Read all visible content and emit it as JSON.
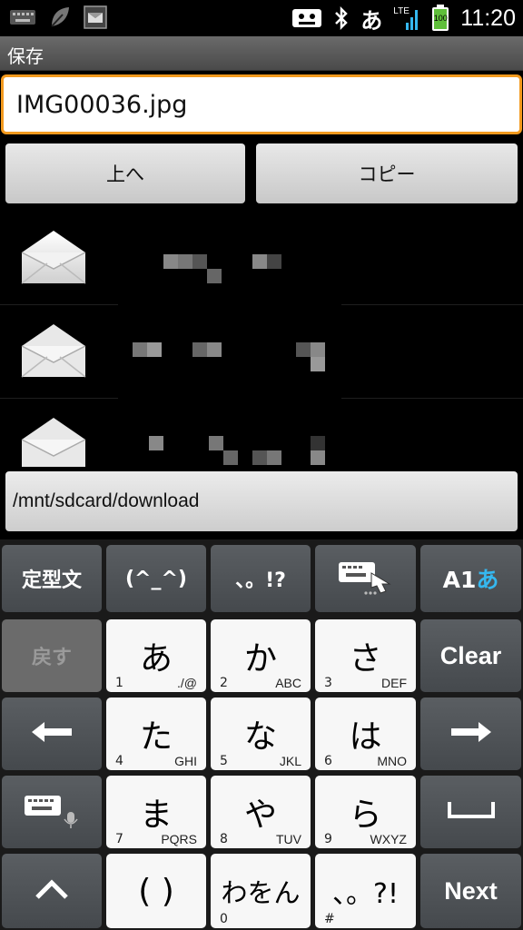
{
  "status_bar": {
    "time": "11:20",
    "input_mode": "あ",
    "network": "LTE",
    "battery": "100"
  },
  "title_bar": {
    "title": "保存"
  },
  "filename_field": {
    "value": "IMG00036.jpg"
  },
  "buttons": {
    "up": "上へ",
    "copy": "コピー"
  },
  "path": "/mnt/sdcard/download",
  "file_list": {
    "items": [
      {
        "icon": "envelope-icon"
      },
      {
        "icon": "envelope-icon"
      },
      {
        "icon": "envelope-icon"
      }
    ]
  },
  "keyboard": {
    "row1": {
      "fixed": "定型文",
      "emoticon": "(^_^)",
      "punct": "、。!?",
      "mode": "A1あ"
    },
    "keys": {
      "back": "戻す",
      "clear": "Clear",
      "next": "Next",
      "a": {
        "main": "あ",
        "num": "1",
        "sub": "./@"
      },
      "ka": {
        "main": "か",
        "num": "2",
        "sub": "ABC"
      },
      "sa": {
        "main": "さ",
        "num": "3",
        "sub": "DEF"
      },
      "ta": {
        "main": "た",
        "num": "4",
        "sub": "GHI"
      },
      "na": {
        "main": "な",
        "num": "5",
        "sub": "JKL"
      },
      "ha": {
        "main": "は",
        "num": "6",
        "sub": "MNO"
      },
      "ma": {
        "main": "ま",
        "num": "7",
        "sub": "PQRS"
      },
      "ya": {
        "main": "や",
        "num": "8",
        "sub": "TUV"
      },
      "ra": {
        "main": "ら",
        "num": "9",
        "sub": "WXYZ"
      },
      "paren": {
        "main": "( )"
      },
      "wa": {
        "main": "わをん",
        "num": "0"
      },
      "punct2": {
        "main": "、。?!",
        "num": "#"
      }
    }
  },
  "colors": {
    "accent": "#f39a1e",
    "mode_blue": "#35b8f0"
  }
}
